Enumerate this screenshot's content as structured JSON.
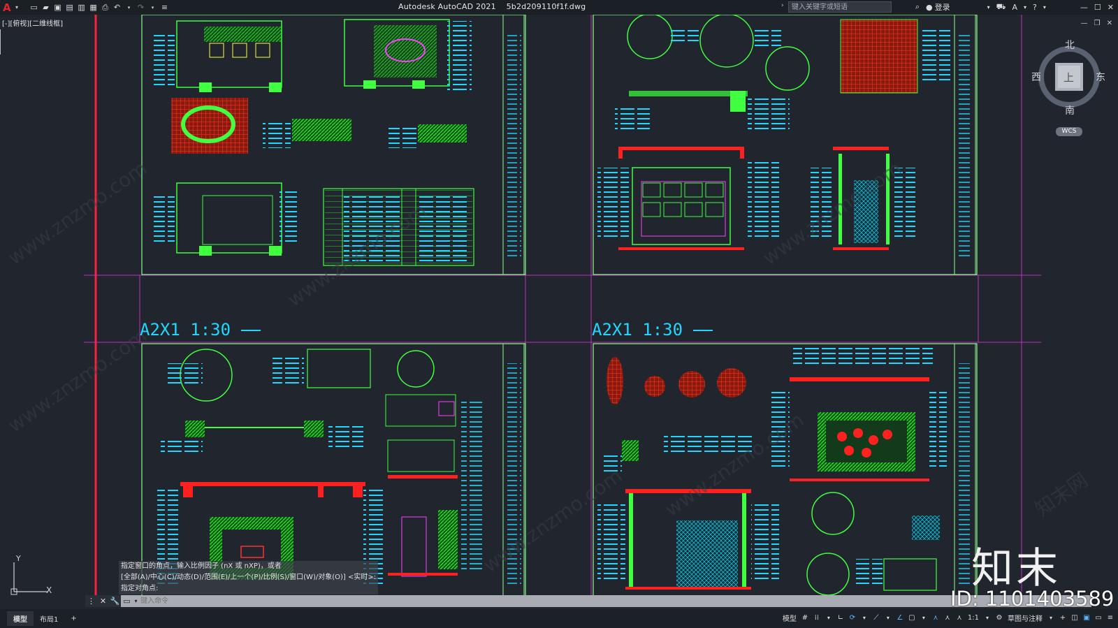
{
  "app": {
    "title": "Autodesk AutoCAD 2021",
    "filename": "5b2d209110f1f.dwg",
    "logo": "A"
  },
  "quick_access": [
    "new-icon",
    "open-icon",
    "save-icon",
    "saveas-icon",
    "plot-preview-icon",
    "publish-icon",
    "print-icon",
    "undo-icon",
    "redo-icon",
    "customize-icon"
  ],
  "search": {
    "placeholder": "键入关键字或短语"
  },
  "user": {
    "login_label": "登录"
  },
  "viewport": {
    "label": "[-][俯视][二维线框]"
  },
  "layouts": [
    {
      "label": "A2X1 1:30"
    },
    {
      "label": "A2X1 1:30"
    }
  ],
  "viewcube": {
    "north": "北",
    "south": "南",
    "east": "东",
    "west": "西",
    "top": "上",
    "wcs": "WCS"
  },
  "ucs": {
    "x": "X",
    "y": "Y"
  },
  "command_history": [
    "指定窗口的角点，输入比例因子 (nX 或 nXP)，或者",
    "[全部(A)/中心(C)/动态(D)/范围(E)/上一个(P)/比例(S)/窗口(W)/对象(O)] <实时>:",
    "指定对角点:"
  ],
  "command_line": {
    "placeholder": "键入命令"
  },
  "watermark": {
    "logo": "知末",
    "id": "ID: 1101403589",
    "url": "www.znzmo.com",
    "site": "知末网"
  },
  "tabs": [
    {
      "label": "模型",
      "active": true
    },
    {
      "label": "布局1",
      "active": false
    },
    {
      "label": "+",
      "active": false
    }
  ],
  "status": {
    "model": "模型",
    "scale": "1:1",
    "workspace": "草图与注释"
  },
  "colors": {
    "background": "#21252d",
    "cyan": "#20d8ff",
    "green": "#30ff30",
    "red": "#ff2020",
    "magenta": "#d030d0"
  }
}
